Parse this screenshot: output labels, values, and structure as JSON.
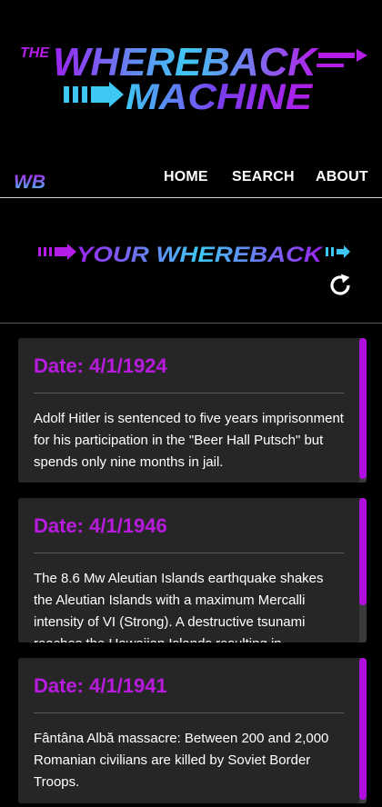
{
  "logo": {
    "the": "THE",
    "line1": "WHEREBACK",
    "line2": "MACHINE"
  },
  "nav": {
    "brand": "WB",
    "links": [
      "HOME",
      "SEARCH",
      "ABOUT"
    ]
  },
  "section_title": "YOUR WHEREBACK",
  "events": [
    {
      "date": "Date: 4/1/1924",
      "text": "Adolf Hitler is sentenced to five years imprisonment for his participation in the \"Beer Hall Putsch\" but spends only nine months in jail."
    },
    {
      "date": "Date: 4/1/1946",
      "text": "The 8.6 Mw Aleutian Islands earthquake shakes the Aleutian Islands with a maximum Mercalli intensity of VI (Strong). A destructive tsunami reaches the Hawaiian Islands resulting in"
    },
    {
      "date": "Date: 4/1/1941",
      "text": "Fântâna Albă massacre: Between 200 and 2,000 Romanian civilians are killed by Soviet Border Troops."
    }
  ],
  "colors": {
    "accent": "#b81bdd",
    "cyan": "#3fc8f4",
    "background": "#000000",
    "card": "#262626"
  },
  "icons": {
    "refresh": "refresh-icon"
  }
}
